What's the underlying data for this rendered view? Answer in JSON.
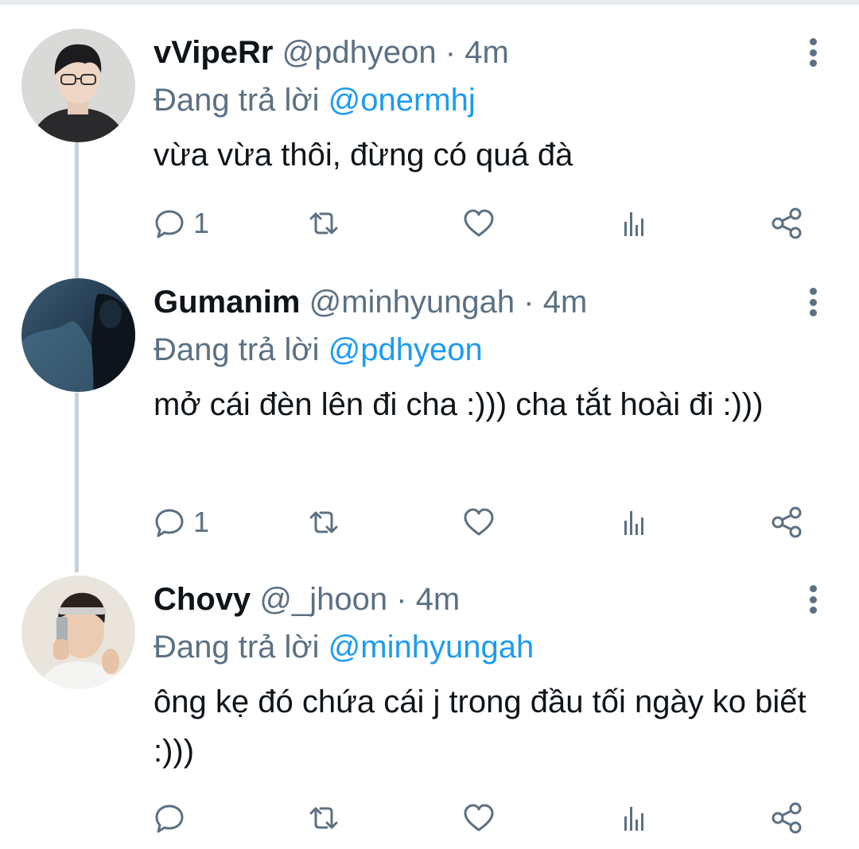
{
  "tweets": [
    {
      "name": "vVipeRr",
      "handle": "@pdhyeon",
      "separator": "·",
      "time": "4m",
      "replying_label": "Đang trả lời",
      "replying_to": "@onermhj",
      "text": "vừa vừa thôi, đừng có quá đà",
      "reply_count": "1",
      "avatar_icon": "person-glasses-avatar"
    },
    {
      "name": "Gumanim",
      "handle": "@minhyungah",
      "separator": "·",
      "time": "4m",
      "replying_label": "Đang trả lời",
      "replying_to": "@pdhyeon",
      "text": "mở cái đèn lên đi cha :))) cha tắt hoài đi :)))",
      "reply_count": "1",
      "avatar_icon": "dark-blue-scene-avatar"
    },
    {
      "name": "Chovy",
      "handle": "@_jhoon",
      "separator": "·",
      "time": "4m",
      "replying_label": "Đang trả lời",
      "replying_to": "@minhyungah",
      "text": "ông kẹ đó chứa cái j trong đầu tối ngày ko biết :)))",
      "reply_count": "",
      "avatar_icon": "selfie-headband-avatar"
    }
  ],
  "colors": {
    "text": "#0f1419",
    "secondary": "#5b7083",
    "link": "#1d9bf0",
    "thread_line": "#c9d0d6"
  },
  "icons": [
    "reply-icon",
    "retweet-icon",
    "like-icon",
    "analytics-icon",
    "share-icon",
    "more-options-icon"
  ]
}
